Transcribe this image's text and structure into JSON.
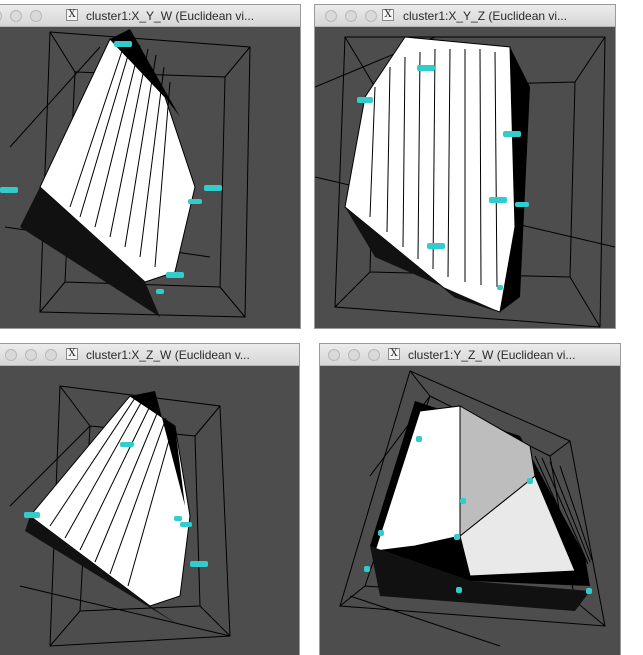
{
  "windows": [
    {
      "title": "cluster1:X_Y_W (Euclidean vi...",
      "x_icon": "X"
    },
    {
      "title": "cluster1:X_Y_Z (Euclidean vi...",
      "x_icon": "X"
    },
    {
      "title": "cluster1:X_Z_W (Euclidean v...",
      "x_icon": "X"
    },
    {
      "title": "cluster1:Y_Z_W (Euclidean vi...",
      "x_icon": "X"
    }
  ],
  "colors": {
    "canvas_bg": "#4d4d4d",
    "wireframe": "#000000",
    "surface": "#ffffff",
    "marker": "#33cccc"
  },
  "icons": [
    "close-icon",
    "minimize-icon",
    "zoom-icon",
    "x11-icon"
  ]
}
